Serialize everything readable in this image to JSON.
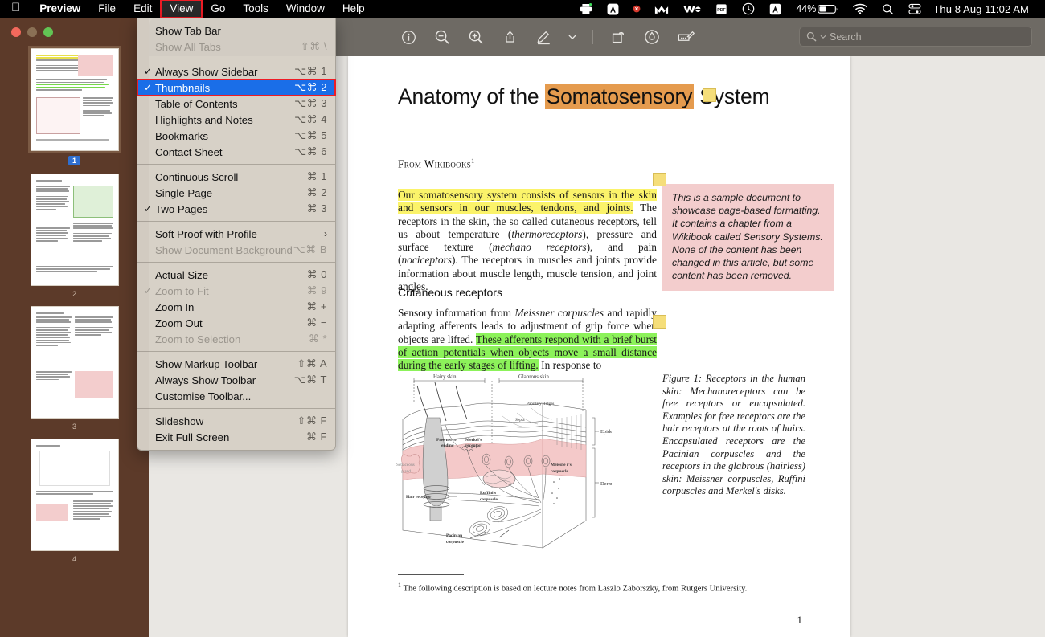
{
  "menubar": {
    "apple_icon": "apple-logo",
    "items": [
      {
        "label": "Preview",
        "bold": true,
        "active": false
      },
      {
        "label": "File",
        "bold": false,
        "active": false
      },
      {
        "label": "Edit",
        "bold": false,
        "active": false
      },
      {
        "label": "View",
        "bold": false,
        "active": true
      },
      {
        "label": "Go",
        "bold": false,
        "active": false
      },
      {
        "label": "Tools",
        "bold": false,
        "active": false
      },
      {
        "label": "Window",
        "bold": false,
        "active": false
      },
      {
        "label": "Help",
        "bold": false,
        "active": false
      }
    ],
    "status": {
      "printer_icon": "printer-icon",
      "app_a_icon": "letter-a-icon",
      "alert_dot_icon": "red-badge-icon",
      "malware_icon": "malwarebytes-m-icon",
      "we_icon": "we-transfer-icon",
      "pdf_icon": "pdf-icon",
      "clock_icon": "history-clock-icon",
      "acrobat_icon": "acrobat-a-icon",
      "battery_percent": "44%",
      "battery_icon": "battery-icon",
      "wifi_icon": "wifi-icon",
      "search_icon": "spotlight-search-icon",
      "control_center_icon": "control-center-icon",
      "datetime": "Thu 8 Aug  11:02 AM"
    },
    "highlight_color": "#ee1c25"
  },
  "view_menu": {
    "groups": [
      [
        {
          "label": "Show Tab Bar",
          "shortcut": "",
          "checked": false,
          "disabled": false,
          "highlighted": false,
          "submenu": false
        },
        {
          "label": "Show All Tabs",
          "shortcut": "⇧⌘ \\",
          "checked": false,
          "disabled": true,
          "highlighted": false,
          "submenu": false
        }
      ],
      [
        {
          "label": "Always Show Sidebar",
          "shortcut": "⌥⌘ 1",
          "checked": true,
          "disabled": false,
          "highlighted": false,
          "submenu": false
        },
        {
          "label": "Thumbnails",
          "shortcut": "⌥⌘ 2",
          "checked": true,
          "disabled": false,
          "highlighted": true,
          "submenu": false
        },
        {
          "label": "Table of Contents",
          "shortcut": "⌥⌘ 3",
          "checked": false,
          "disabled": false,
          "highlighted": false,
          "submenu": false
        },
        {
          "label": "Highlights and Notes",
          "shortcut": "⌥⌘ 4",
          "checked": false,
          "disabled": false,
          "highlighted": false,
          "submenu": false
        },
        {
          "label": "Bookmarks",
          "shortcut": "⌥⌘ 5",
          "checked": false,
          "disabled": false,
          "highlighted": false,
          "submenu": false
        },
        {
          "label": "Contact Sheet",
          "shortcut": "⌥⌘ 6",
          "checked": false,
          "disabled": false,
          "highlighted": false,
          "submenu": false
        }
      ],
      [
        {
          "label": "Continuous Scroll",
          "shortcut": "⌘ 1",
          "checked": false,
          "disabled": false,
          "highlighted": false,
          "submenu": false
        },
        {
          "label": "Single Page",
          "shortcut": "⌘ 2",
          "checked": false,
          "disabled": false,
          "highlighted": false,
          "submenu": false
        },
        {
          "label": "Two Pages",
          "shortcut": "⌘ 3",
          "checked": true,
          "disabled": false,
          "highlighted": false,
          "submenu": false
        }
      ],
      [
        {
          "label": "Soft Proof with Profile",
          "shortcut": "",
          "checked": false,
          "disabled": false,
          "highlighted": false,
          "submenu": true
        },
        {
          "label": "Show Document Background",
          "shortcut": "⌥⌘ B",
          "checked": false,
          "disabled": true,
          "highlighted": false,
          "submenu": false
        }
      ],
      [
        {
          "label": "Actual Size",
          "shortcut": "⌘ 0",
          "checked": false,
          "disabled": false,
          "highlighted": false,
          "submenu": false
        },
        {
          "label": "Zoom to Fit",
          "shortcut": "⌘ 9",
          "checked": true,
          "disabled": true,
          "highlighted": false,
          "submenu": false
        },
        {
          "label": "Zoom In",
          "shortcut": "⌘ +",
          "checked": false,
          "disabled": false,
          "highlighted": false,
          "submenu": false
        },
        {
          "label": "Zoom Out",
          "shortcut": "⌘ −",
          "checked": false,
          "disabled": false,
          "highlighted": false,
          "submenu": false
        },
        {
          "label": "Zoom to Selection",
          "shortcut": "⌘ *",
          "checked": false,
          "disabled": true,
          "highlighted": false,
          "submenu": false
        }
      ],
      [
        {
          "label": "Show Markup Toolbar",
          "shortcut": "⇧⌘ A",
          "checked": false,
          "disabled": false,
          "highlighted": false,
          "submenu": false
        },
        {
          "label": "Always Show Toolbar",
          "shortcut": "⌥⌘ T",
          "checked": false,
          "disabled": false,
          "highlighted": false,
          "submenu": false
        },
        {
          "label": "Customise Toolbar...",
          "shortcut": "",
          "checked": false,
          "disabled": false,
          "highlighted": false,
          "submenu": false
        }
      ],
      [
        {
          "label": "Slideshow",
          "shortcut": "⇧⌘ F",
          "checked": false,
          "disabled": false,
          "highlighted": false,
          "submenu": false
        },
        {
          "label": "Exit Full Screen",
          "shortcut": "⌘ F",
          "checked": false,
          "disabled": false,
          "highlighted": false,
          "submenu": false
        }
      ]
    ]
  },
  "window": {
    "traffic_lights": [
      "close-button",
      "minimize-button",
      "zoom-button"
    ],
    "toolbar_icons": [
      "info-icon",
      "zoom-out-icon",
      "zoom-in-icon",
      "share-icon",
      "markup-pen-icon",
      "chevron-down-icon",
      "rotate-icon",
      "annotate-icon",
      "signature-icon"
    ],
    "search": {
      "placeholder": "Search",
      "icon": "search-icon"
    }
  },
  "sidebar": {
    "thumbnails": [
      {
        "page_label": "1",
        "selected": true
      },
      {
        "page_label": "2",
        "selected": false
      },
      {
        "page_label": "3",
        "selected": false
      },
      {
        "page_label": "4",
        "selected": false
      }
    ]
  },
  "document": {
    "title_pre": "Anatomy of the ",
    "title_highlight": "Somatosensory",
    "title_post": " System",
    "source": "From Wikibooks",
    "source_sup": "1",
    "paragraph1": {
      "highlighted": "Our somatosensory system consists of sensors in the skin and sensors in our muscles, tendons, and joints.",
      "rest_a": " The receptors in the skin, the so called cutaneous receptors, tell us about temperature (",
      "italic_a": "thermoreceptors",
      "rest_b": "), pressure and surface texture (",
      "italic_b": "mechano receptors",
      "rest_c": "), and pain (",
      "italic_c": "nociceptors",
      "rest_d": "). The receptors in muscles and joints provide information about muscle length, muscle tension, and joint angles."
    },
    "section_heading": "Cutaneous receptors",
    "paragraph2": {
      "plain_a": "Sensory information from ",
      "italic_a": "Meissner corpuscles",
      "plain_b": " and rapidly adapting afferents leads to adjustment of grip force when objects are lifted. ",
      "highlighted": "These afferents respond with a brief burst of action potentials when objects move a small distance during the early stages of lifting.",
      "plain_c": " In response to"
    },
    "note": "This is a sample document to showcase page-based formatting. It contains a chapter from a Wikibook called Sensory Systems. None of the content has been changed in this article, but some content has been removed.",
    "figure_caption": "Figure 1:  Receptors in the human skin: Mechanoreceptors can be free receptors or encapsulated. Examples for free receptors are the hair receptors at the roots of hairs. Encapsulated receptors are the Pacinian corpuscles and the receptors in the glabrous (hairless) skin: Meissner corpuscles, Ruffini corpuscles and Merkel's disks.",
    "footnote_sup": "1",
    "footnote": "The following description is based on lecture notes from Laszlo Zaborszky, from Rutgers University.",
    "page_number": "1",
    "figure_labels": {
      "hairy_skin": "Hairy skin",
      "glabrous_skin": "Glabrous skin",
      "papillary_ridges": "Papillary Ridges",
      "septa": "Septa",
      "epidermis": "Epidermis",
      "dermis": "Dermis",
      "free_nerve_ending": "Free nerve ending",
      "merkel_receptor": "Merkel's receptor",
      "sebaceous_gland": "Sebaceous gland",
      "hair_receptor": "Hair receptor",
      "ruffini_corpuscle": "Ruffini's corpuscle",
      "pacinian_corpuscle": "Pacinian corpuscle",
      "meissner_corpuscle": "Meissne r's corpuscle"
    },
    "highlight_colors": {
      "title": "#e59b4e",
      "yellow": "#fbf36a",
      "green": "#8cf25a",
      "note_pink": "#f3cdcd",
      "sticky": "#f5de7a"
    },
    "sticky_notes": 3
  }
}
